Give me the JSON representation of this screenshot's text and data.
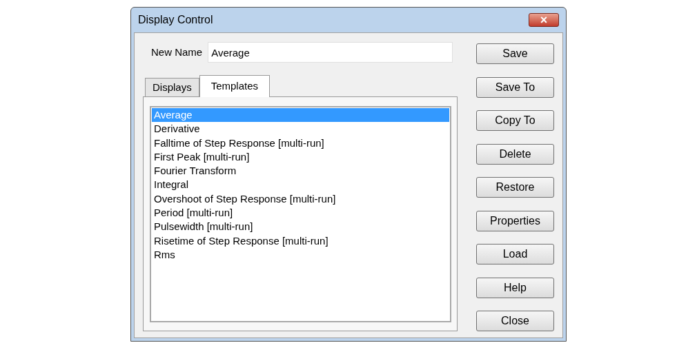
{
  "window": {
    "title": "Display Control",
    "close": "×"
  },
  "name_field": {
    "label": "New Name",
    "value": "Average"
  },
  "tabs": [
    {
      "label": "Displays",
      "selected": false
    },
    {
      "label": "Templates",
      "selected": true
    }
  ],
  "list": [
    {
      "label": "Average",
      "selected": true
    },
    {
      "label": "Derivative",
      "selected": false
    },
    {
      "label": "Falltime of Step Response [multi-run]",
      "selected": false
    },
    {
      "label": "First Peak [multi-run]",
      "selected": false
    },
    {
      "label": "Fourier Transform",
      "selected": false
    },
    {
      "label": "Integral",
      "selected": false
    },
    {
      "label": "Overshoot of Step Response [multi-run]",
      "selected": false
    },
    {
      "label": "Period [multi-run]",
      "selected": false
    },
    {
      "label": "Pulsewidth [multi-run]",
      "selected": false
    },
    {
      "label": "Risetime of Step Response [multi-run]",
      "selected": false
    },
    {
      "label": "Rms",
      "selected": false
    }
  ],
  "buttons": [
    "Save",
    "Save To",
    "Copy To",
    "Delete",
    "Restore",
    "Properties",
    "Load",
    "Help",
    "Close"
  ]
}
